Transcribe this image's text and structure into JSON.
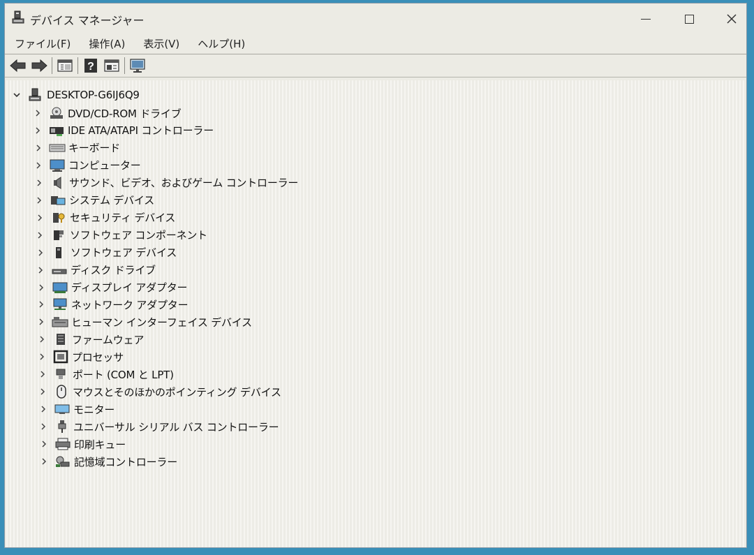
{
  "window": {
    "title": "デバイス マネージャー"
  },
  "menu": [
    {
      "label": "ファイル(F)",
      "name": "menu-file"
    },
    {
      "label": "操作(A)",
      "name": "menu-action"
    },
    {
      "label": "表示(V)",
      "name": "menu-view"
    },
    {
      "label": "ヘルプ(H)",
      "name": "menu-help"
    }
  ],
  "toolbar": [
    "back-icon",
    "forward-icon",
    "properties-icon",
    "help-icon",
    "update-driver-icon",
    "scan-hardware-icon"
  ],
  "tree": {
    "root": "DESKTOP-G6IJ6Q9",
    "items": [
      {
        "label": "DVD/CD-ROM ドライブ",
        "icon": "dvd-drive-icon"
      },
      {
        "label": "IDE ATA/ATAPI コントローラー",
        "icon": "ide-controller-icon"
      },
      {
        "label": "キーボード",
        "icon": "keyboard-icon"
      },
      {
        "label": "コンピューター",
        "icon": "computer-icon"
      },
      {
        "label": "サウンド、ビデオ、およびゲーム コントローラー",
        "icon": "speaker-icon"
      },
      {
        "label": "システム デバイス",
        "icon": "system-device-icon"
      },
      {
        "label": "セキュリティ デバイス",
        "icon": "security-device-icon"
      },
      {
        "label": "ソフトウェア コンポーネント",
        "icon": "software-component-icon"
      },
      {
        "label": "ソフトウェア デバイス",
        "icon": "software-device-icon"
      },
      {
        "label": "ディスク ドライブ",
        "icon": "disk-drive-icon"
      },
      {
        "label": "ディスプレイ アダプター",
        "icon": "display-adapter-icon"
      },
      {
        "label": "ネットワーク アダプター",
        "icon": "network-adapter-icon"
      },
      {
        "label": "ヒューマン インターフェイス デバイス",
        "icon": "hid-icon"
      },
      {
        "label": "ファームウェア",
        "icon": "firmware-icon"
      },
      {
        "label": "プロセッサ",
        "icon": "processor-icon"
      },
      {
        "label": "ポート (COM と LPT)",
        "icon": "port-icon"
      },
      {
        "label": "マウスとそのほかのポインティング デバイス",
        "icon": "mouse-icon"
      },
      {
        "label": "モニター",
        "icon": "monitor-icon"
      },
      {
        "label": "ユニバーサル シリアル バス コントローラー",
        "icon": "usb-icon"
      },
      {
        "label": "印刷キュー",
        "icon": "printer-icon"
      },
      {
        "label": "記憶域コントローラー",
        "icon": "storage-controller-icon"
      }
    ]
  }
}
